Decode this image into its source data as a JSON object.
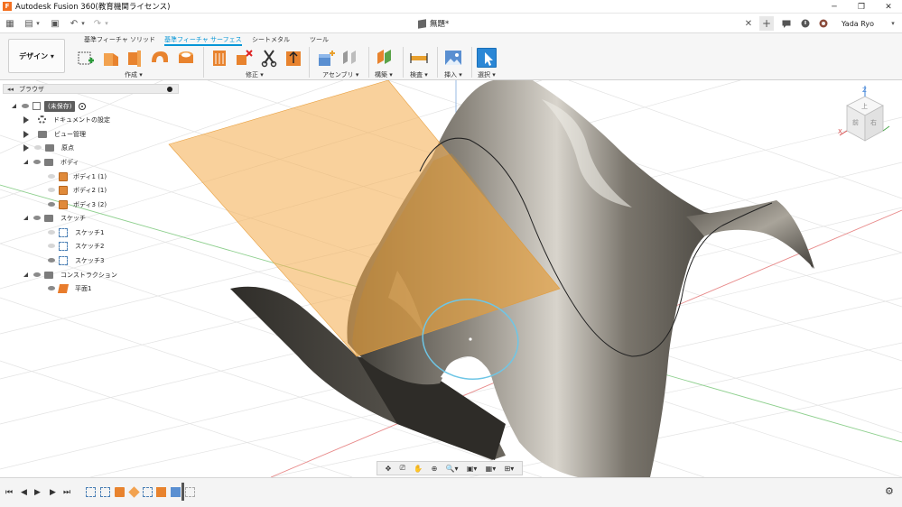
{
  "titlebar": {
    "title": "Autodesk Fusion 360(教育機関ライセンス)",
    "logo": "F",
    "minimize": "─",
    "maximize": "❐",
    "close": "✕"
  },
  "quickaccess": {
    "grid_icon": "▦",
    "file_icon": "▤",
    "file_caret": "▾",
    "save_icon": "▣",
    "undo_icon": "↶",
    "undo_caret": "▾",
    "redo_icon": "↷",
    "redo_caret": "▾",
    "doc_title": "無題*",
    "close_tab": "✕",
    "new_tab": "+",
    "user": "Yada Ryo",
    "user_caret": "▾"
  },
  "ribbon": {
    "workspace_button": "デザイン ▾",
    "tabs": [
      "基準フィーチャ ソリッド",
      "基準フィーチャ サーフェス",
      "シートメタル",
      "ツール"
    ],
    "groups": [
      "作成 ▾",
      "修正 ▾",
      "アセンブリ ▾",
      "構築 ▾",
      "検査 ▾",
      "挿入 ▾",
      "選択 ▾"
    ]
  },
  "browser": {
    "header": "ブラウザ",
    "root": "(未保存)",
    "items": [
      {
        "label": "ドキュメントの設定"
      },
      {
        "label": "ビュー管理"
      },
      {
        "label": "原点"
      },
      {
        "label": "ボディ"
      },
      {
        "label": "ボディ1 (1)"
      },
      {
        "label": "ボディ2 (1)"
      },
      {
        "label": "ボディ3 (2)"
      },
      {
        "label": "スケッチ"
      },
      {
        "label": "スケッチ1"
      },
      {
        "label": "スケッチ2"
      },
      {
        "label": "スケッチ3"
      },
      {
        "label": "コンストラクション"
      },
      {
        "label": "平面1"
      }
    ]
  },
  "viewcube": {
    "z": "Z",
    "x": "X",
    "top": "上",
    "front": "前",
    "right": "右"
  },
  "navbar": {
    "orbit": "✥",
    "lookat": "⎚",
    "pan": "✋",
    "zoom": "⊕",
    "fit": "🔍▾",
    "display": "▣▾",
    "grid": "▦▾",
    "viewports": "⊞▾"
  },
  "timeline": {
    "first": "⏮",
    "prev": "◀",
    "play": "▶",
    "next": "▶",
    "last": "⏭",
    "settings": "⚙"
  },
  "colors": {
    "accent": "#0696d7",
    "plane": "#f5b25a",
    "surface": "#6e6a64",
    "sketch_circle": "#6ec6e6"
  }
}
